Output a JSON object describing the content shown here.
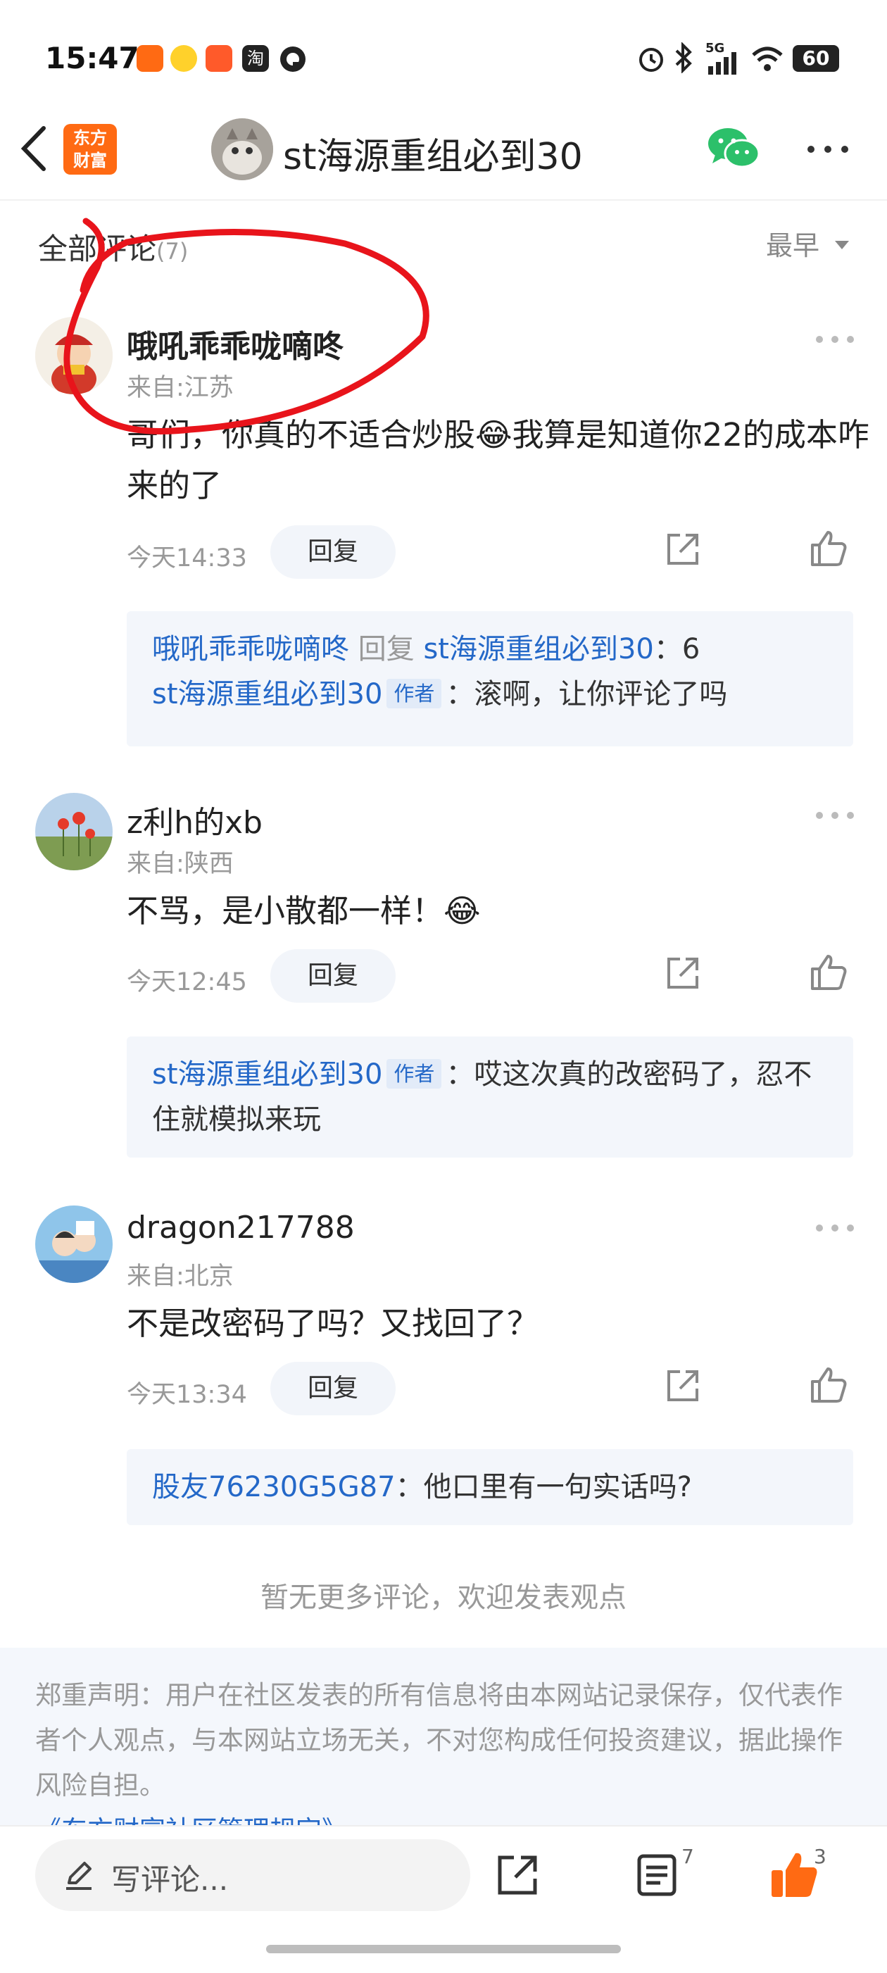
{
  "status_bar": {
    "time": "15:47",
    "battery": "60",
    "network": "5G",
    "app_icons": [
      "send-app-icon",
      "mascot-app-icon",
      "app-icon",
      "taobao-icon",
      "q-app-icon"
    ]
  },
  "header": {
    "brand_line1": "东方",
    "brand_line2": "财富",
    "title": "st海源重组必到30",
    "brand_color": "#ff6a13",
    "wechat_color": "#2cc06a"
  },
  "section": {
    "title": "全部评论",
    "count": "(7)",
    "sort_label": "最早"
  },
  "comments": [
    {
      "nick": "哦吼乖乖咙嘀咚",
      "location": "来自:江苏",
      "text": "哥们，你真的不适合炒股😂我算是知道你22的成本咋来的了",
      "time": "今天14:33",
      "reply_label": "回复",
      "replies": [
        {
          "from": "哦吼乖乖咙嘀咚",
          "mid": "回复",
          "to": "st海源重组必到30",
          "text": "：6"
        },
        {
          "from": "st海源重组必到30",
          "tag": "作者",
          "text": "：滚啊，让你评论了吗"
        }
      ]
    },
    {
      "nick": "z利h的xb",
      "location": "来自:陕西",
      "text": "不骂，是小散都一样！😂",
      "time": "今天12:45",
      "reply_label": "回复",
      "replies": [
        {
          "from": "st海源重组必到30",
          "tag": "作者",
          "text": "：哎这次真的改密码了，忍不住就模拟来玩"
        }
      ]
    },
    {
      "nick": "dragon217788",
      "location": "来自:北京",
      "text": "不是改密码了吗？又找回了？",
      "time": "今天13:34",
      "reply_label": "回复",
      "replies": [
        {
          "from": "股友76230G5G87",
          "text": "：他口里有一句实话吗?"
        }
      ]
    }
  ],
  "no_more": "暂无更多评论，欢迎发表观点",
  "disclaimer": {
    "text": "郑重声明：用户在社区发表的所有信息将由本网站记录保存，仅代表作者个人观点，与本网站立场无关，不对您构成任何投资建议，据此操作风险自担。",
    "link": "《东方财富社区管理规定》"
  },
  "bottom_bar": {
    "input_placeholder": "写评论...",
    "comment_count": "7",
    "like_count": "3",
    "like_color": "#ff6a13"
  },
  "annotation": {
    "color": "#e8141b"
  },
  "link_color": "#2468c8"
}
